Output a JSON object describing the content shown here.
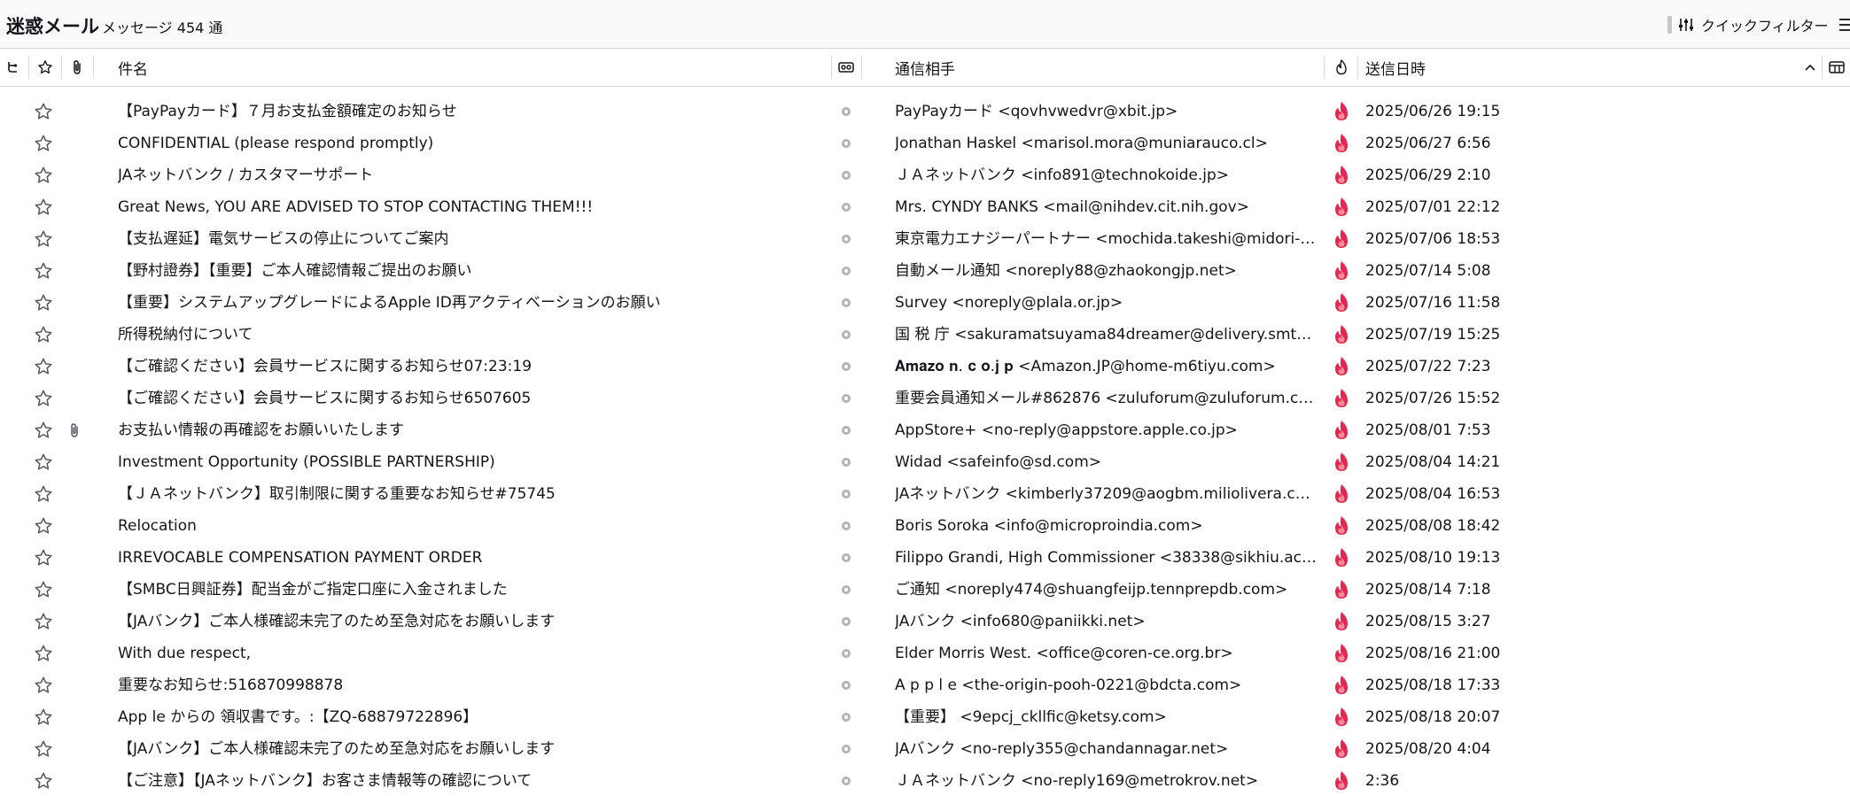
{
  "header": {
    "folder_title": "迷惑メール",
    "message_count": "メッセージ 454 通",
    "quick_filter_label": "クイックフィルター"
  },
  "columns": {
    "subject": "件名",
    "correspondent": "通信相手",
    "date": "送信日時"
  },
  "icons": {
    "thread": "thread-icon",
    "star": "star-icon",
    "attachment": "attachment-icon",
    "read_status": "read-status-icon",
    "junk_status": "junk-flame-icon",
    "sort_ascending": "chevron-up-icon",
    "column_picker": "column-picker-icon",
    "quick_filter": "sliders-icon",
    "menu": "hamburger-menu-icon"
  },
  "colors": {
    "junk_flame": "#e22850",
    "junk_flame_inner": "#ff8a9a",
    "star_outline": "#5b5b66",
    "read_dot": "#b1b1b9"
  },
  "messages": [
    {
      "subject": "【PayPayカード】７月お支払金額確定のお知らせ",
      "correspondent": "PayPayカード <qovhvwedvr@xbit.jp>",
      "date": "2025/06/26 19:15",
      "attachment": false
    },
    {
      "subject": "CONFIDENTIAL (please respond promptly)",
      "correspondent": "Jonathan Haskel <marisol.mora@muniarauco.cl>",
      "date": "2025/06/27 6:56",
      "attachment": false
    },
    {
      "subject": "JAネットバンク / カスタマーサポート",
      "correspondent": "ＪＡネットバンク <info891@technokoide.jp>",
      "date": "2025/06/29 2:10",
      "attachment": false
    },
    {
      "subject": "Great News, YOU ARE ADVISED TO STOP CONTACTING THEM!!!",
      "correspondent": "Mrs. CYNDY BANKS <mail@nihdev.cit.nih.gov>",
      "date": "2025/07/01 22:12",
      "attachment": false
    },
    {
      "subject": "【支払遅延】電気サービスの停止についてご案内",
      "correspondent": "東京電力エナジーパートナー <mochida.takeshi@midori-store....",
      "date": "2025/07/06 18:53",
      "attachment": false
    },
    {
      "subject": "【野村證券】【重要】ご本人確認情報ご提出のお願い",
      "correspondent": "自動メール通知 <noreply88@zhaokongjp.net>",
      "date": "2025/07/14 5:08",
      "attachment": false
    },
    {
      "subject": "【重要】システムアップグレードによるApple ID再アクティベーションのお願い",
      "correspondent": "Survey <noreply@plala.or.jp>",
      "date": "2025/07/16 11:58",
      "attachment": false
    },
    {
      "subject": "所得税納付について",
      "correspondent": "国 税 庁 <sakuramatsuyama84dreamer@delivery.smtp.mic...",
      "date": "2025/07/19 15:25",
      "attachment": false
    },
    {
      "subject": "【ご確認ください】会員サービスに関するお知らせ07:23:19",
      "correspondent": "𝐀𝐦𝐚𝐳𝐨 𝐧. 𝐜 𝐨.𝐣 𝐩 <Amazon.JP@home-m6tiyu.com>",
      "date": "2025/07/22 7:23",
      "attachment": false
    },
    {
      "subject": "【ご確認ください】会員サービスに関するお知らせ6507605",
      "correspondent": "重要会員通知メール#862876 <zuluforum@zuluforum.com>",
      "date": "2025/07/26 15:52",
      "attachment": false
    },
    {
      "subject": "お支払い情報の再確認をお願いいたします",
      "correspondent": "AppStore+ <no-reply@appstore.apple.co.jp>",
      "date": "2025/08/01 7:53",
      "attachment": true
    },
    {
      "subject": "Investment Opportunity (POSSIBLE PARTNERSHIP)",
      "correspondent": "Widad <safeinfo@sd.com>",
      "date": "2025/08/04 14:21",
      "attachment": false
    },
    {
      "subject": "【ＪＡネットバンク】取引制限に関する重要なお知らせ#75745",
      "correspondent": "JAネットバンク <kimberly37209@aogbm.miliolivera.com>",
      "date": "2025/08/04 16:53",
      "attachment": false
    },
    {
      "subject": "Relocation",
      "correspondent": "Boris Soroka <info@microproindia.com>",
      "date": "2025/08/08 18:42",
      "attachment": false
    },
    {
      "subject": "IRREVOCABLE COMPENSATION PAYMENT ORDER",
      "correspondent": "Filippo Grandi, High Commissioner <38338@sikhiu.ac.th>",
      "date": "2025/08/10 19:13",
      "attachment": false
    },
    {
      "subject": "【SMBC日興証券】配当金がご指定口座に入金されました",
      "correspondent": "ご通知 <noreply474@shuangfeijp.tennprepdb.com>",
      "date": "2025/08/14 7:18",
      "attachment": false
    },
    {
      "subject": "【JAバンク】ご本人様確認未完了のため至急対応をお願いします",
      "correspondent": "JAバンク <info680@paniikki.net>",
      "date": "2025/08/15 3:27",
      "attachment": false
    },
    {
      "subject": "With due respect,",
      "correspondent": "Elder Morris West. <office@coren-ce.org.br>",
      "date": "2025/08/16 21:00",
      "attachment": false
    },
    {
      "subject": "重要なお知らせ:516870998878",
      "correspondent": "A p p l e <the-origin-pooh-0221@bdcta.com>",
      "date": "2025/08/18 17:33",
      "attachment": false
    },
    {
      "subject": "App le からの 領収書です。:【ZQ-68879722896】",
      "correspondent": "【重要】 <9epcj_ckllfic@ketsy.com>",
      "date": "2025/08/18 20:07",
      "attachment": false
    },
    {
      "subject": "【JAバンク】ご本人様確認未完了のため至急対応をお願いします",
      "correspondent": "JAバンク <no-reply355@chandannagar.net>",
      "date": "2025/08/20 4:04",
      "attachment": false
    },
    {
      "subject": "【ご注意】【JAネットバンク】お客さま情報等の確認について",
      "correspondent": "ＪＡネットバンク <no-reply169@metrokrov.net>",
      "date": "2:36",
      "attachment": false
    }
  ]
}
